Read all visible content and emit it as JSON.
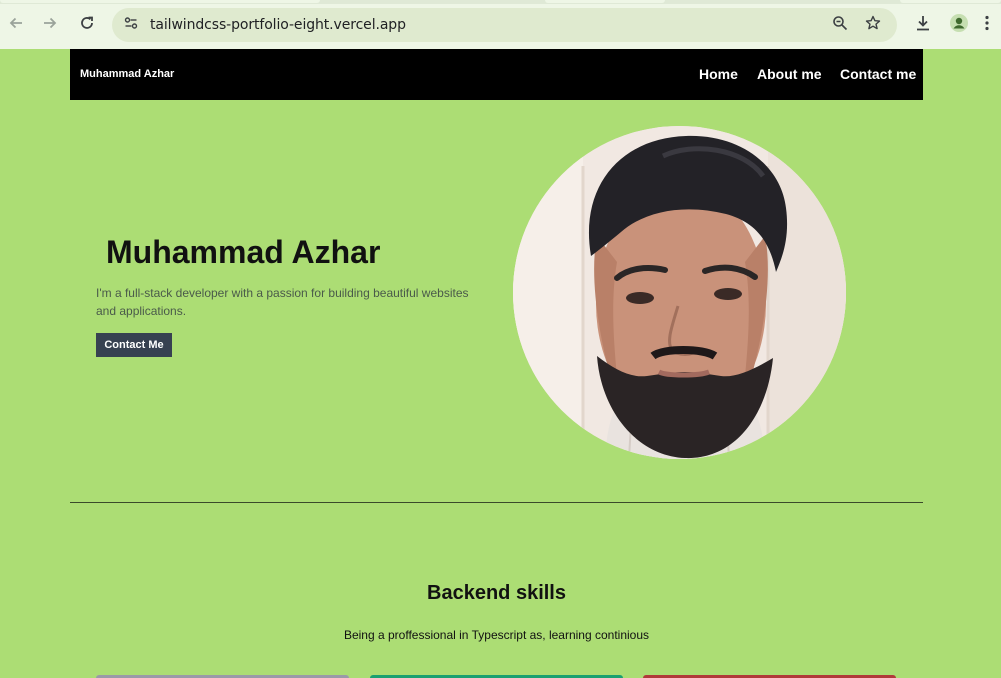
{
  "browser": {
    "url": "tailwindcss-portfolio-eight.vercel.app",
    "icons": [
      "back-arrow-icon",
      "forward-arrow-icon",
      "reload-icon",
      "site-info-icon",
      "zoom-icon",
      "star-icon",
      "download-icon",
      "profile-icon",
      "more-icon"
    ]
  },
  "nav": {
    "brand": "Muhammad Azhar",
    "links": [
      "Home",
      "About me",
      "Contact me"
    ]
  },
  "hero": {
    "name": "Muhammad Azhar",
    "description": "I'm a full-stack developer with a passion for building beautiful websites and applications.",
    "cta_label": "Contact Me"
  },
  "skills": {
    "title": "Backend skills",
    "subtitle": "Being a proffessional in Typescript as, learning continious"
  },
  "colors": {
    "page_bg": "#acdd74",
    "navbar_bg": "#000000",
    "cta_bg": "#374151",
    "card_colors": [
      "#9a9aa8",
      "#1aa070",
      "#b03a3a"
    ]
  }
}
